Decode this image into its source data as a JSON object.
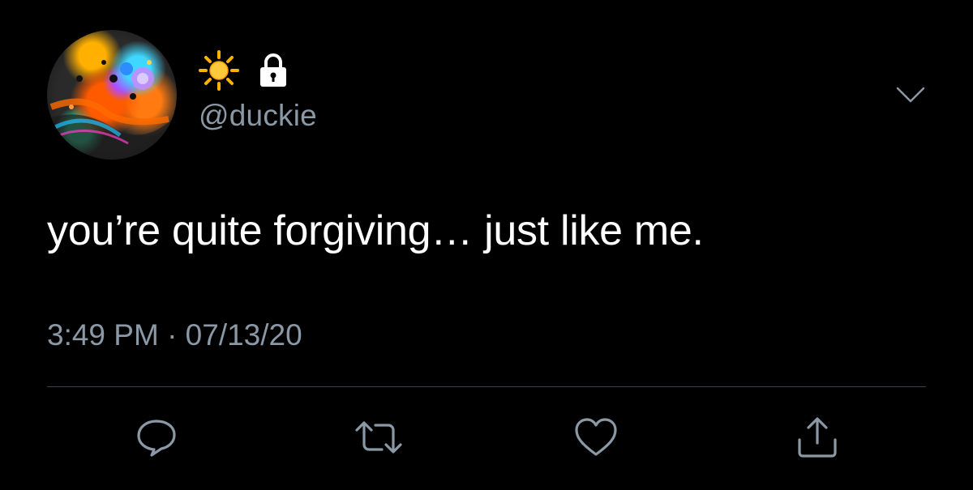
{
  "tweet": {
    "display_name_emojis": [
      "sun-icon",
      "lock-icon"
    ],
    "handle": "@duckie",
    "text": "you’re quite forgiving… just like me.",
    "timestamp": "3:49 PM · 07/13/20"
  },
  "actions": [
    "reply-icon",
    "retweet-icon",
    "like-icon",
    "share-icon"
  ],
  "colors": {
    "background": "#000000",
    "text": "#ffffff",
    "secondary_text": "#8b98a5",
    "divider": "#38444d",
    "sun": "#ffb300"
  }
}
